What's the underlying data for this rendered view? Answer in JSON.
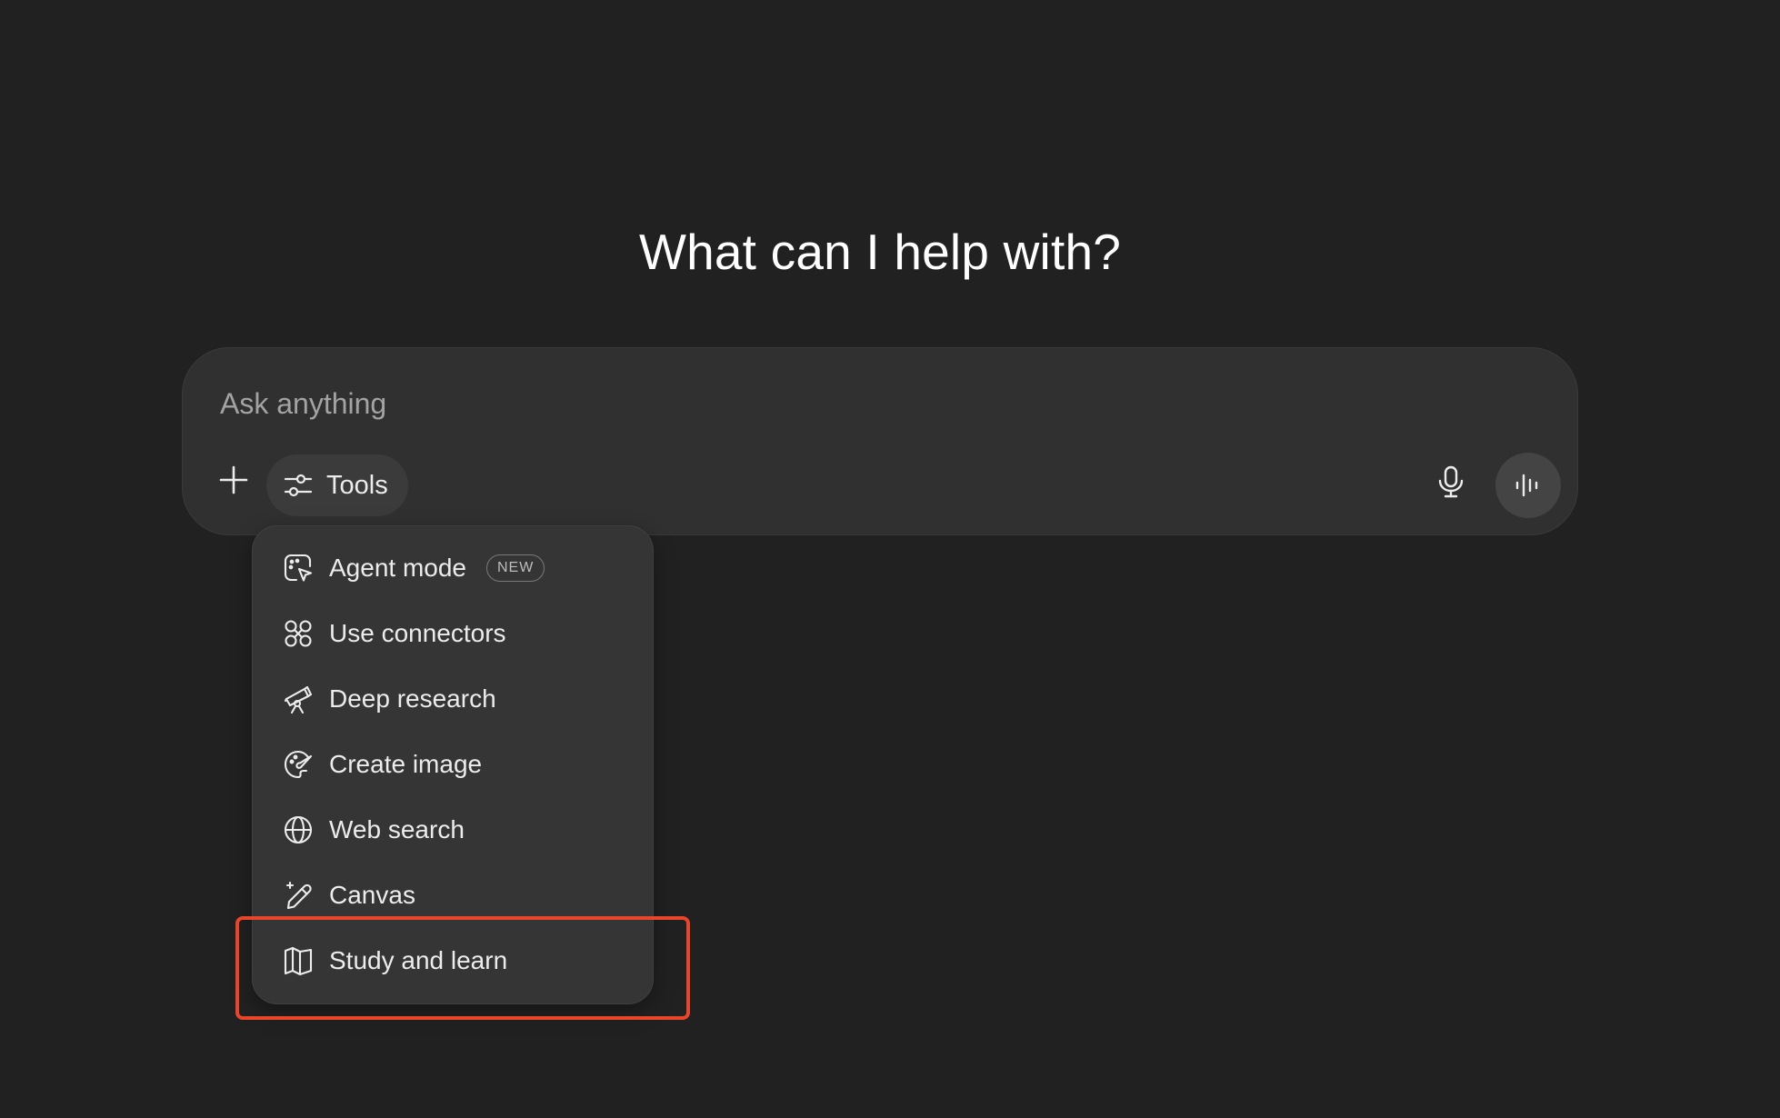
{
  "headline": "What can I help with?",
  "composer": {
    "placeholder": "Ask anything",
    "value": "",
    "plus_icon": "plus-icon",
    "tools_label": "Tools",
    "tools_icon": "sliders-icon",
    "mic_icon": "microphone-icon",
    "voice_icon": "voice-waveform-icon"
  },
  "tools_menu": {
    "items": [
      {
        "label": "Agent mode",
        "icon": "agent-cursor-icon",
        "badge": "NEW"
      },
      {
        "label": "Use connectors",
        "icon": "connectors-icon"
      },
      {
        "label": "Deep research",
        "icon": "telescope-icon"
      },
      {
        "label": "Create image",
        "icon": "palette-icon"
      },
      {
        "label": "Web search",
        "icon": "globe-icon"
      },
      {
        "label": "Canvas",
        "icon": "pencil-sparkle-icon"
      },
      {
        "label": "Study and learn",
        "icon": "book-icon"
      }
    ]
  },
  "annotation": {
    "highlight_color": "#e8452b",
    "highlighted_item": "Study and learn"
  },
  "colors": {
    "background": "#212121",
    "composer": "#303030",
    "menu": "#353535",
    "text": "#ececec",
    "placeholder": "#a3a3a3"
  }
}
